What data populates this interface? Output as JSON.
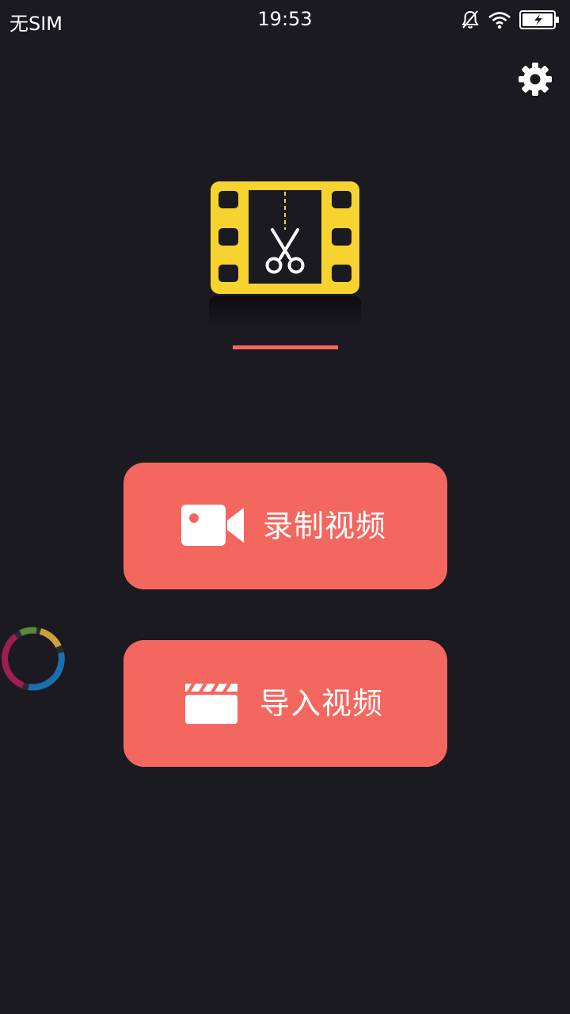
{
  "status_bar": {
    "carrier": "无SIM",
    "time": "19:53",
    "icons": [
      "mute-bell-icon",
      "wifi-icon",
      "battery-charging-icon"
    ]
  },
  "header": {
    "settings_icon": "gear-icon"
  },
  "logo": {
    "icon": "film-scissors-icon",
    "frame_color": "#f6d32e",
    "accent_color": "#f4675f"
  },
  "actions": {
    "record": {
      "label": "录制视频",
      "icon": "video-camera-icon"
    },
    "import": {
      "label": "导入视频",
      "icon": "clapperboard-icon"
    },
    "button_color": "#f4675f"
  },
  "floating_widget": {
    "icon": "loading-ring-icon"
  },
  "colors": {
    "background": "#1b1a21",
    "accent": "#f4675f",
    "logo_yellow": "#f6d32e"
  }
}
